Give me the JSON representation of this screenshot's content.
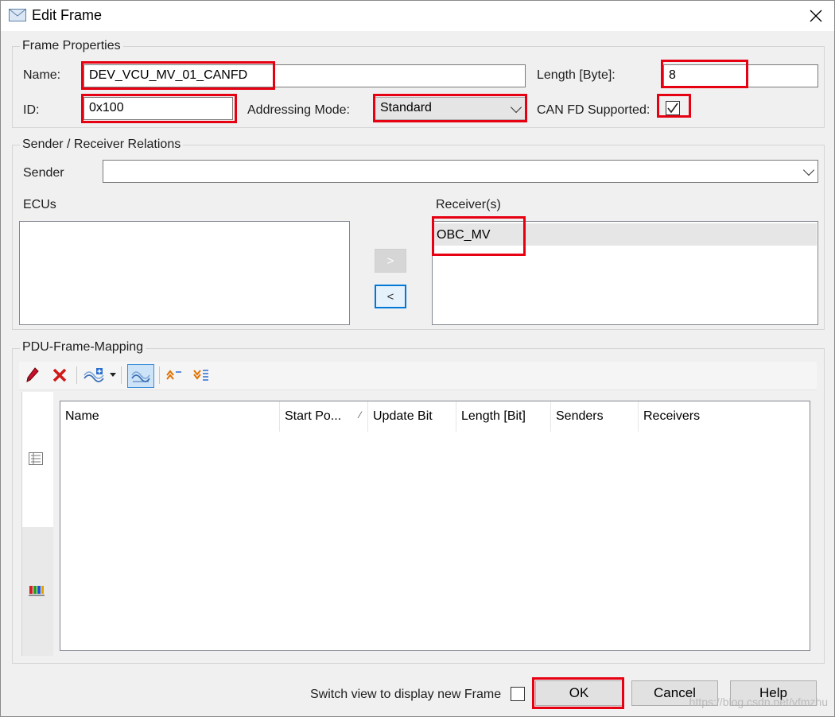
{
  "window": {
    "title": "Edit Frame"
  },
  "frame_properties": {
    "group_label": "Frame Properties",
    "name_label": "Name:",
    "name_value": "DEV_VCU_MV_01_CANFD",
    "length_label": "Length [Byte]:",
    "length_value": "8",
    "id_label": "ID:",
    "id_value": "0x100",
    "addressing_label": "Addressing Mode:",
    "addressing_value": "Standard",
    "canfd_label": "CAN FD Supported:",
    "canfd_checked": true
  },
  "relations": {
    "group_label": "Sender / Receiver Relations",
    "sender_label": "Sender",
    "sender_value": "",
    "ecus_label": "ECUs",
    "ecus": [],
    "receivers_label": "Receiver(s)",
    "receivers": [
      "OBC_MV"
    ],
    "add_button": ">",
    "remove_button": "<"
  },
  "mapping": {
    "group_label": "PDU-Frame-Mapping",
    "toolbar": [
      "edit-icon",
      "delete-icon",
      "add-pdu-icon",
      "dropdown-icon",
      "view-icon",
      "move-up-icon",
      "move-down-icon"
    ],
    "columns": [
      "Name",
      "Start Po...",
      "Update Bit",
      "Length [Bit]",
      "Senders",
      "Receivers"
    ],
    "sort_indicator": "⁄",
    "rows": []
  },
  "footer": {
    "switch_label": "Switch view to display new Frame",
    "switch_checked": false,
    "ok_label": "OK",
    "cancel_label": "Cancel",
    "help_label": "Help"
  },
  "watermark": "https://blog.csdn.net/vfmzhu",
  "colors": {
    "highlight": "#e60012",
    "focus": "#0078d7",
    "window_bg": "#f0f0f0"
  }
}
